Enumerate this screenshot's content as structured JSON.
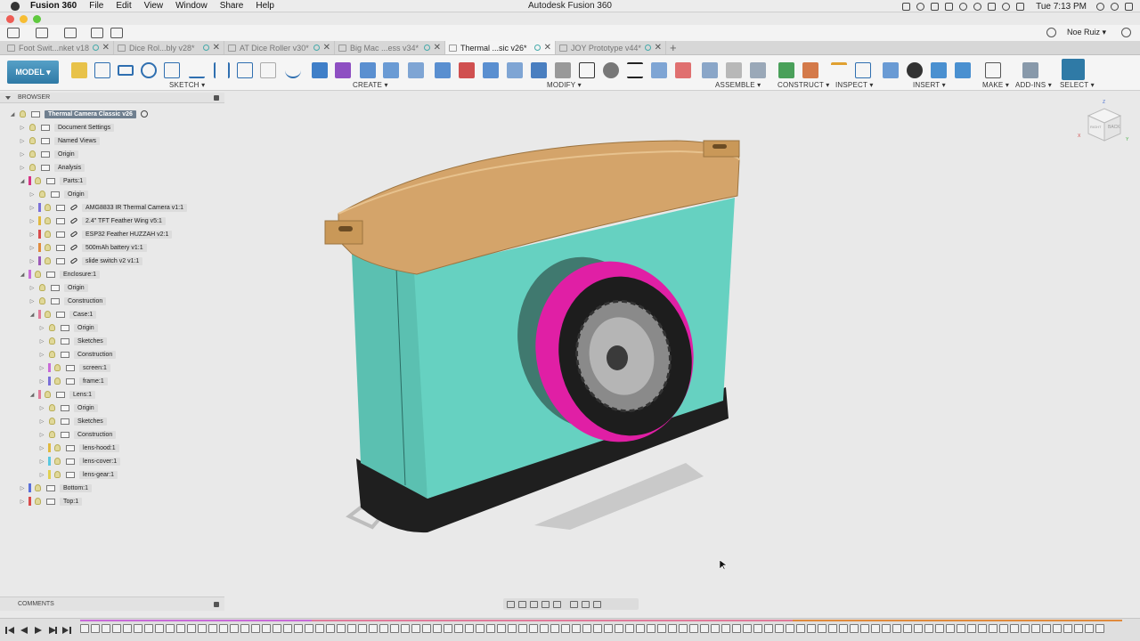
{
  "menubar": {
    "app_name": "Fusion 360",
    "items": [
      "File",
      "Edit",
      "View",
      "Window",
      "Share",
      "Help"
    ],
    "window_title": "Autodesk Fusion 360",
    "clock": "Tue 7:13 PM",
    "status_icons": [
      "camera-icon",
      "notification-icon",
      "dropbox-icon",
      "battery-icon",
      "record-icon",
      "time-machine-icon",
      "bluetooth-icon",
      "wifi-icon",
      "display-icon",
      "user-icon",
      "search-icon",
      "list-icon"
    ]
  },
  "quick_access": {
    "user_name": "Noe Ruiz ▾"
  },
  "doc_tabs": [
    {
      "label": "Foot Swit...nket v18*",
      "active": false
    },
    {
      "label": "Dice Rol...bly v28*",
      "active": false
    },
    {
      "label": "AT Dice Roller v30*",
      "active": false
    },
    {
      "label": "Big Mac ...ess v34*",
      "active": false
    },
    {
      "label": "Thermal ...sic v26*",
      "active": true
    },
    {
      "label": "JOY Prototype v44*",
      "active": false
    }
  ],
  "ribbon": {
    "workspace": "MODEL ▾",
    "groups": [
      "SKETCH ▾",
      "CREATE ▾",
      "MODIFY ▾",
      "ASSEMBLE ▾",
      "CONSTRUCT ▾",
      "INSPECT ▾",
      "INSERT ▾",
      "MAKE ▾",
      "ADD-INS ▾",
      "SELECT ▾"
    ]
  },
  "browser": {
    "header": "BROWSER",
    "root": "Thermal Camera Classic v26",
    "nodes": [
      {
        "label": "Document Settings",
        "depth": 1,
        "exp": "▷",
        "color": ""
      },
      {
        "label": "Named Views",
        "depth": 1,
        "exp": "▷",
        "color": ""
      },
      {
        "label": "Origin",
        "depth": 1,
        "exp": "▷",
        "color": ""
      },
      {
        "label": "Analysis",
        "depth": 1,
        "exp": "▷",
        "color": ""
      },
      {
        "label": "Parts:1",
        "depth": 1,
        "exp": "◢",
        "color": "#d63384"
      },
      {
        "label": "Origin",
        "depth": 2,
        "exp": "▷",
        "color": ""
      },
      {
        "label": "AMG8833 IR Thermal Camera v1:1",
        "depth": 2,
        "exp": "▷",
        "color": "#7a6fd8",
        "link": true
      },
      {
        "label": "2.4\" TFT Feather Wing v5:1",
        "depth": 2,
        "exp": "▷",
        "color": "#e0b940",
        "link": true
      },
      {
        "label": "ESP32 Feather HUZZAH v2:1",
        "depth": 2,
        "exp": "▷",
        "color": "#d84b4b",
        "link": true
      },
      {
        "label": "500mAh battery v1:1",
        "depth": 2,
        "exp": "▷",
        "color": "#e08a3c",
        "link": true
      },
      {
        "label": "slide switch v2 v1:1",
        "depth": 2,
        "exp": "▷",
        "color": "#9b59b6",
        "link": true
      },
      {
        "label": "Enclosure:1",
        "depth": 1,
        "exp": "◢",
        "color": "#c86bd8"
      },
      {
        "label": "Origin",
        "depth": 2,
        "exp": "▷",
        "color": ""
      },
      {
        "label": "Construction",
        "depth": 2,
        "exp": "▷",
        "color": ""
      },
      {
        "label": "Case:1",
        "depth": 2,
        "exp": "◢",
        "color": "#e07a9a"
      },
      {
        "label": "Origin",
        "depth": 3,
        "exp": "▷",
        "color": ""
      },
      {
        "label": "Sketches",
        "depth": 3,
        "exp": "▷",
        "color": ""
      },
      {
        "label": "Construction",
        "depth": 3,
        "exp": "▷",
        "color": ""
      },
      {
        "label": "screen:1",
        "depth": 3,
        "exp": "▷",
        "color": "#c86bd8"
      },
      {
        "label": "frame:1",
        "depth": 3,
        "exp": "▷",
        "color": "#7a6fd8"
      },
      {
        "label": "Lens:1",
        "depth": 2,
        "exp": "◢",
        "color": "#e07a9a"
      },
      {
        "label": "Origin",
        "depth": 3,
        "exp": "▷",
        "color": ""
      },
      {
        "label": "Sketches",
        "depth": 3,
        "exp": "▷",
        "color": ""
      },
      {
        "label": "Construction",
        "depth": 3,
        "exp": "▷",
        "color": ""
      },
      {
        "label": "lens-hood:1",
        "depth": 3,
        "exp": "▷",
        "color": "#e0b940"
      },
      {
        "label": "lens-cover:1",
        "depth": 3,
        "exp": "▷",
        "color": "#5ac8e0"
      },
      {
        "label": "lens-gear:1",
        "depth": 3,
        "exp": "▷",
        "color": "#e0d050"
      },
      {
        "label": "Bottom:1",
        "depth": 1,
        "exp": "▷",
        "color": "#5a6fd8"
      },
      {
        "label": "Top:1",
        "depth": 1,
        "exp": "▷",
        "color": "#d84b4b"
      }
    ]
  },
  "comments": {
    "header": "COMMENTS"
  },
  "viewcube": {
    "front_label": "RIGHT",
    "back_label": "BACK",
    "axis_z": "Z",
    "axis_x": "X",
    "axis_y": "Y"
  },
  "colors": {
    "case": "#66d1c1",
    "top": "#d4a46a",
    "bottom": "#1f1f1f",
    "lens_hood": "#e01fa5",
    "accent": "#2f7aa6"
  }
}
